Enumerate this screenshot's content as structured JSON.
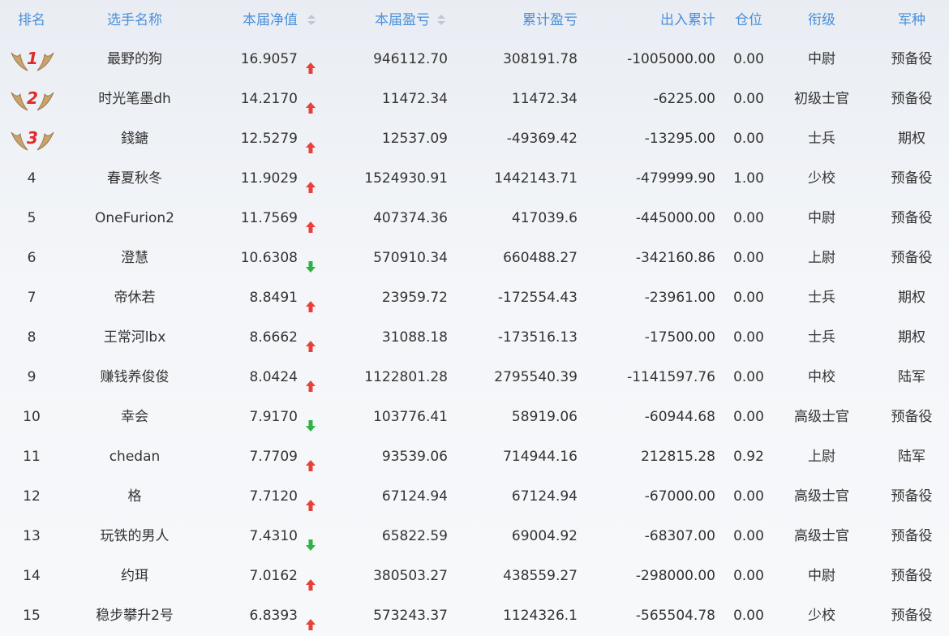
{
  "header": {
    "rank": "排名",
    "name": "选手名称",
    "nav": "本届净值",
    "pnl": "本届盈亏",
    "cumulative": "累计盈亏",
    "flow": "出入累计",
    "position": "仓位",
    "title": "衔级",
    "branch": "军种"
  },
  "colors": {
    "header_text": "#4a90d9",
    "up_arrow": "#e8413b",
    "down_arrow": "#2fb344",
    "medal_number": "#e02a2a",
    "wing": "#c9a36b"
  },
  "rows": [
    {
      "rank": "1",
      "medal": true,
      "name": "最野的狗",
      "nav": "16.9057",
      "trend": "up",
      "pnl": "946112.70",
      "cumulative": "308191.78",
      "flow": "-1005000.00",
      "position": "0.00",
      "title": "中尉",
      "branch": "预备役"
    },
    {
      "rank": "2",
      "medal": true,
      "name": "时光笔墨dh",
      "nav": "14.2170",
      "trend": "up",
      "pnl": "11472.34",
      "cumulative": "11472.34",
      "flow": "-6225.00",
      "position": "0.00",
      "title": "初级士官",
      "branch": "预备役"
    },
    {
      "rank": "3",
      "medal": true,
      "name": "錢鎕",
      "nav": "12.5279",
      "trend": "up",
      "pnl": "12537.09",
      "cumulative": "-49369.42",
      "flow": "-13295.00",
      "position": "0.00",
      "title": "士兵",
      "branch": "期权"
    },
    {
      "rank": "4",
      "medal": false,
      "name": "春夏秋冬",
      "nav": "11.9029",
      "trend": "up",
      "pnl": "1524930.91",
      "cumulative": "1442143.71",
      "flow": "-479999.90",
      "position": "1.00",
      "title": "少校",
      "branch": "预备役"
    },
    {
      "rank": "5",
      "medal": false,
      "name": "OneFurion2",
      "nav": "11.7569",
      "trend": "up",
      "pnl": "407374.36",
      "cumulative": "417039.6",
      "flow": "-445000.00",
      "position": "0.00",
      "title": "中尉",
      "branch": "预备役"
    },
    {
      "rank": "6",
      "medal": false,
      "name": "澄慧",
      "nav": "10.6308",
      "trend": "down",
      "pnl": "570910.34",
      "cumulative": "660488.27",
      "flow": "-342160.86",
      "position": "0.00",
      "title": "上尉",
      "branch": "预备役"
    },
    {
      "rank": "7",
      "medal": false,
      "name": "帝休若",
      "nav": "8.8491",
      "trend": "up",
      "pnl": "23959.72",
      "cumulative": "-172554.43",
      "flow": "-23961.00",
      "position": "0.00",
      "title": "士兵",
      "branch": "期权"
    },
    {
      "rank": "8",
      "medal": false,
      "name": "王常河lbx",
      "nav": "8.6662",
      "trend": "up",
      "pnl": "31088.18",
      "cumulative": "-173516.13",
      "flow": "-17500.00",
      "position": "0.00",
      "title": "士兵",
      "branch": "期权"
    },
    {
      "rank": "9",
      "medal": false,
      "name": "赚钱养俊俊",
      "nav": "8.0424",
      "trend": "up",
      "pnl": "1122801.28",
      "cumulative": "2795540.39",
      "flow": "-1141597.76",
      "position": "0.00",
      "title": "中校",
      "branch": "陆军"
    },
    {
      "rank": "10",
      "medal": false,
      "name": "幸会",
      "nav": "7.9170",
      "trend": "down",
      "pnl": "103776.41",
      "cumulative": "58919.06",
      "flow": "-60944.68",
      "position": "0.00",
      "title": "高级士官",
      "branch": "预备役"
    },
    {
      "rank": "11",
      "medal": false,
      "name": "chedan",
      "nav": "7.7709",
      "trend": "up",
      "pnl": "93539.06",
      "cumulative": "714944.16",
      "flow": "212815.28",
      "position": "0.92",
      "title": "上尉",
      "branch": "陆军"
    },
    {
      "rank": "12",
      "medal": false,
      "name": "格",
      "nav": "7.7120",
      "trend": "up",
      "pnl": "67124.94",
      "cumulative": "67124.94",
      "flow": "-67000.00",
      "position": "0.00",
      "title": "高级士官",
      "branch": "预备役"
    },
    {
      "rank": "13",
      "medal": false,
      "name": "玩铁的男人",
      "nav": "7.4310",
      "trend": "down",
      "pnl": "65822.59",
      "cumulative": "69004.92",
      "flow": "-68307.00",
      "position": "0.00",
      "title": "高级士官",
      "branch": "预备役"
    },
    {
      "rank": "14",
      "medal": false,
      "name": "约珥",
      "nav": "7.0162",
      "trend": "up",
      "pnl": "380503.27",
      "cumulative": "438559.27",
      "flow": "-298000.00",
      "position": "0.00",
      "title": "中尉",
      "branch": "预备役"
    },
    {
      "rank": "15",
      "medal": false,
      "name": "稳步攀升2号",
      "nav": "6.8393",
      "trend": "up",
      "pnl": "573243.37",
      "cumulative": "1124326.1",
      "flow": "-565504.78",
      "position": "0.00",
      "title": "少校",
      "branch": "预备役"
    }
  ]
}
